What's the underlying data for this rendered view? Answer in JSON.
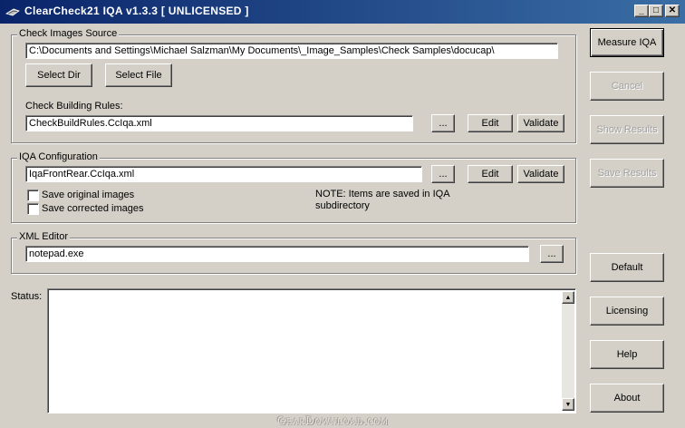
{
  "window": {
    "title": "ClearCheck21 IQA v1.3.3  [ UNLICENSED ]",
    "minimize": "_",
    "maximize": "□",
    "close": "✕"
  },
  "check_images": {
    "legend": "Check Images Source",
    "path_value": "C:\\Documents and Settings\\Michael Salzman\\My Documents\\_Image_Samples\\Check Samples\\docucap\\",
    "select_dir": "Select Dir",
    "select_file": "Select File",
    "rules_label": "Check Building Rules:",
    "rules_value": "CheckBuildRules.CcIqa.xml",
    "browse": "...",
    "edit": "Edit",
    "validate": "Validate"
  },
  "iqa_config": {
    "legend": "IQA Configuration",
    "value": "IqaFrontRear.CcIqa.xml",
    "browse": "...",
    "edit": "Edit",
    "validate": "Validate",
    "save_original": "Save original images",
    "save_corrected": "Save corrected images",
    "save_original_checked": false,
    "save_corrected_checked": false,
    "note_line1": "NOTE:  Items are saved in IQA",
    "note_line2": "subdirectory"
  },
  "xml_editor": {
    "legend": "XML Editor",
    "value": "notepad.exe",
    "browse": "..."
  },
  "status": {
    "label": "Status:",
    "text": ""
  },
  "side_buttons": {
    "measure_iqa": "Measure IQA",
    "cancel": "Cancel",
    "show_results": "Show Results",
    "save_results": "Save Results",
    "default": "Default",
    "licensing": "Licensing",
    "help": "Help",
    "about": "About"
  },
  "watermark": "GearDownload.com"
}
